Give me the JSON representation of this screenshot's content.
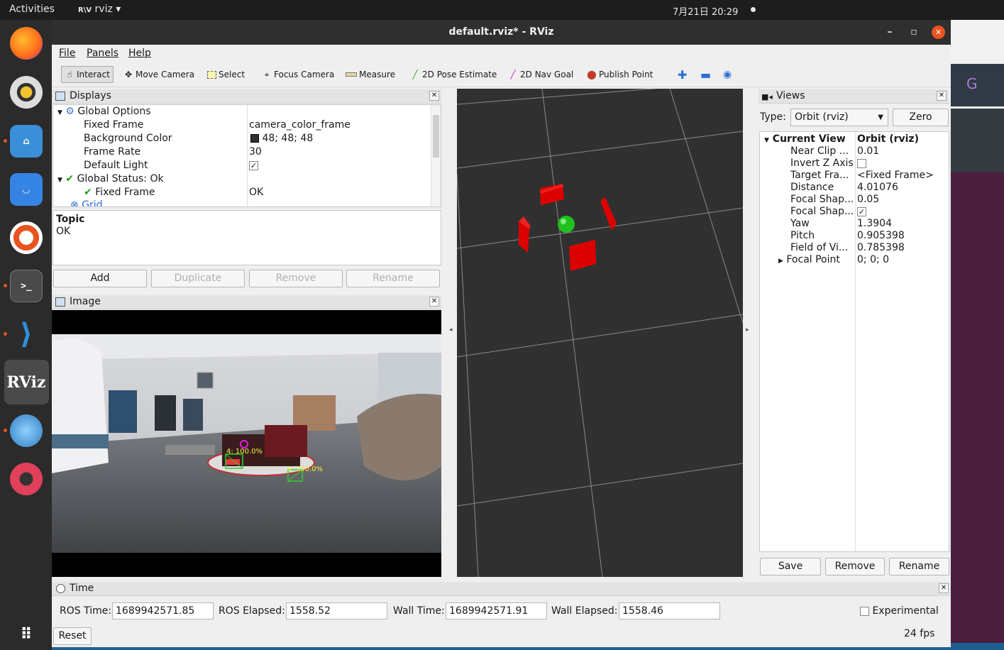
{
  "topbar": {
    "activities": "Activities",
    "app": "rviz",
    "clock": "7月21日  20:29"
  },
  "window": {
    "title": "default.rviz* - RViz"
  },
  "menu": {
    "file": "File",
    "panels": "Panels",
    "help": "Help"
  },
  "toolbar": {
    "interact": "Interact",
    "move_camera": "Move Camera",
    "select": "Select",
    "focus_camera": "Focus Camera",
    "measure": "Measure",
    "pose_estimate": "2D Pose Estimate",
    "nav_goal": "2D Nav Goal",
    "publish_point": "Publish Point"
  },
  "displays": {
    "title": "Displays",
    "rows": [
      {
        "label": "Global Options",
        "value": ""
      },
      {
        "label": "Fixed Frame",
        "value": "camera_color_frame"
      },
      {
        "label": "Background Color",
        "value": "48; 48; 48"
      },
      {
        "label": "Frame Rate",
        "value": "30"
      },
      {
        "label": "Default Light",
        "value": ""
      },
      {
        "label": "Global Status: Ok",
        "value": ""
      },
      {
        "label": "Fixed Frame",
        "value": "OK"
      },
      {
        "label": "Grid",
        "value": ""
      }
    ],
    "desc_title": "Topic",
    "desc_text": "OK",
    "buttons": {
      "add": "Add",
      "duplicate": "Duplicate",
      "remove": "Remove",
      "rename": "Rename"
    }
  },
  "image_panel": {
    "title": "Image",
    "det1": "4: 100.0%",
    "det2": "4: 100.0%"
  },
  "views": {
    "title": "Views",
    "type_label": "Type:",
    "type_value": "Orbit (rviz)",
    "zero": "Zero",
    "rows": [
      {
        "label": "Current View",
        "value": "Orbit (rviz)"
      },
      {
        "label": "Near Clip ...",
        "value": "0.01"
      },
      {
        "label": "Invert Z Axis",
        "value": ""
      },
      {
        "label": "Target Fra...",
        "value": "<Fixed Frame>"
      },
      {
        "label": "Distance",
        "value": "4.01076"
      },
      {
        "label": "Focal Shap...",
        "value": "0.05"
      },
      {
        "label": "Focal Shap...",
        "value": ""
      },
      {
        "label": "Yaw",
        "value": "1.3904"
      },
      {
        "label": "Pitch",
        "value": "0.905398"
      },
      {
        "label": "Field of Vi...",
        "value": "0.785398"
      },
      {
        "label": "Focal Point",
        "value": "0; 0; 0"
      }
    ],
    "buttons": {
      "save": "Save",
      "remove": "Remove",
      "rename": "Rename"
    }
  },
  "time": {
    "title": "Time",
    "ros_time_label": "ROS Time:",
    "ros_time": "1689942571.85",
    "ros_elapsed_label": "ROS Elapsed:",
    "ros_elapsed": "1558.52",
    "wall_time_label": "Wall Time:",
    "wall_time": "1689942571.91",
    "wall_elapsed_label": "Wall Elapsed:",
    "wall_elapsed": "1558.46",
    "experimental": "Experimental",
    "reset": "Reset",
    "fps": "24 fps"
  },
  "dock": [
    "firefox-icon",
    "rhythmbox-icon",
    "files-icon",
    "software-icon",
    "help-icon",
    "terminal-icon",
    "vscode-icon",
    "rviz-icon",
    "browser-icon",
    "ring-icon",
    "apps-grid-icon"
  ]
}
